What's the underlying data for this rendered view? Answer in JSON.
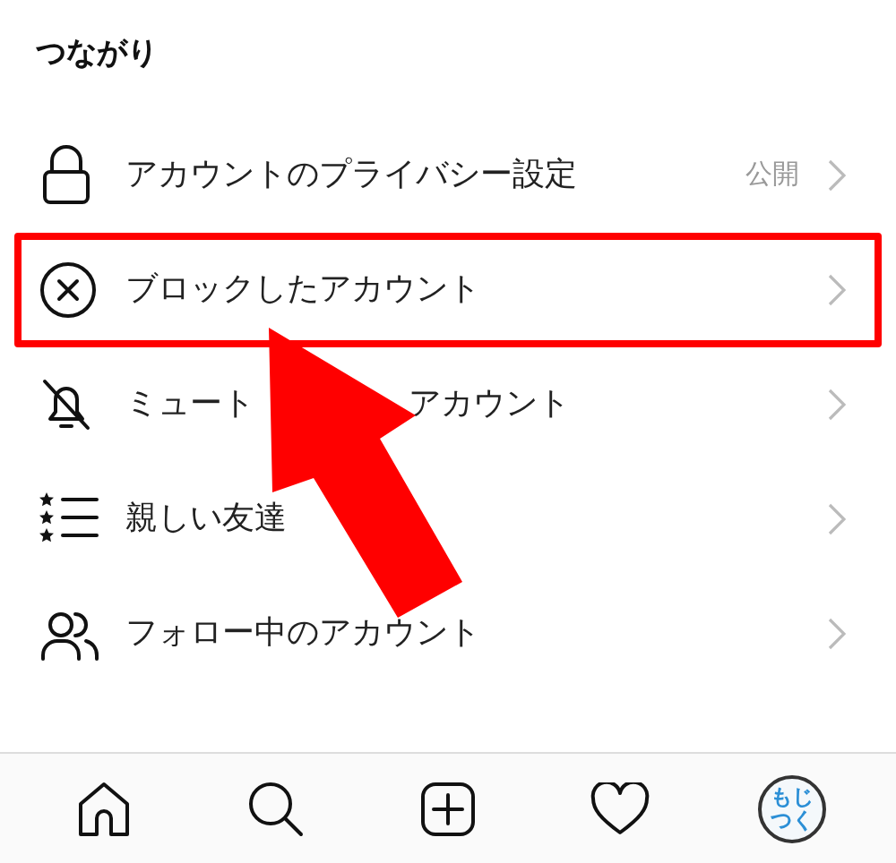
{
  "section_title": "つながり",
  "items": [
    {
      "label_parts": [
        "アカウントのプライバシー設定"
      ],
      "value": "公開",
      "highlighted": false
    },
    {
      "label_parts": [
        "ブロックしたアカウント"
      ],
      "highlighted": true
    },
    {
      "label_parts": [
        "ミュート",
        "アカウント"
      ],
      "highlighted": false
    },
    {
      "label_parts": [
        "親しい友達"
      ],
      "highlighted": false
    },
    {
      "label_parts": [
        "フォロー中のアカウント"
      ],
      "highlighted": false
    }
  ],
  "avatar_lines": [
    "もじ",
    "つく"
  ]
}
